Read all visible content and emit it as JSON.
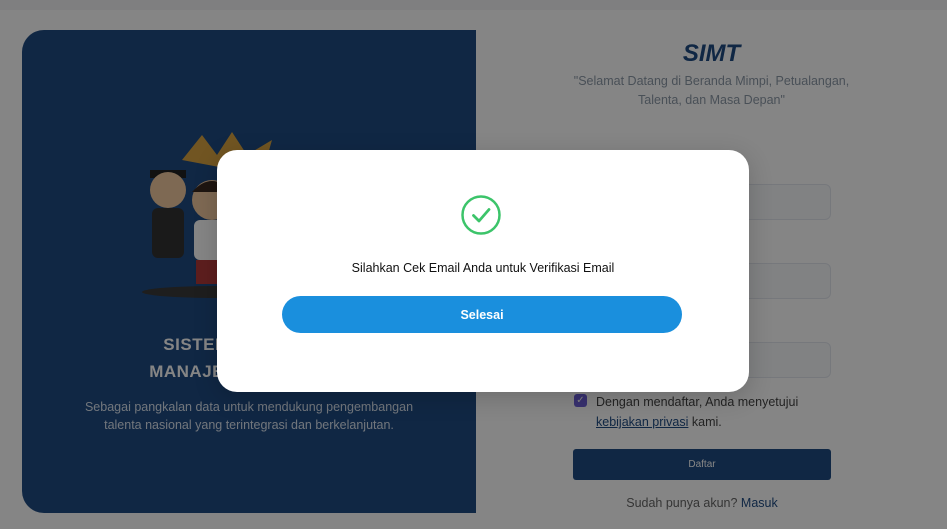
{
  "hero": {
    "title_line1": "SISTEM INFORMASI",
    "title_line2": "MANAJEMEN TALENTA",
    "description": "Sebagai pangkalan data untuk mendukung pengembangan talenta nasional yang terintegrasi dan berkelanjutan."
  },
  "form": {
    "brand": "SIMT",
    "tagline": "\"Selamat Datang di Beranda Mimpi, Petualangan, Talenta, dan Masa Depan\"",
    "consent_prefix": "Dengan mendaftar, Anda menyetujui",
    "consent_link": "kebijakan privasi",
    "consent_suffix": " kami.",
    "register_label": "Daftar",
    "login_prompt": "Sudah punya akun? ",
    "login_link": "Masuk"
  },
  "modal": {
    "icon": "check-circle-icon",
    "message": "Silahkan Cek Email Anda untuk Verifikasi Email",
    "button_label": "Selesai"
  },
  "colors": {
    "primary": "#1f4b82",
    "accent": "#1a8fdd",
    "success": "#3cc46a",
    "overlay": "rgba(0,0,0,0.48)"
  }
}
